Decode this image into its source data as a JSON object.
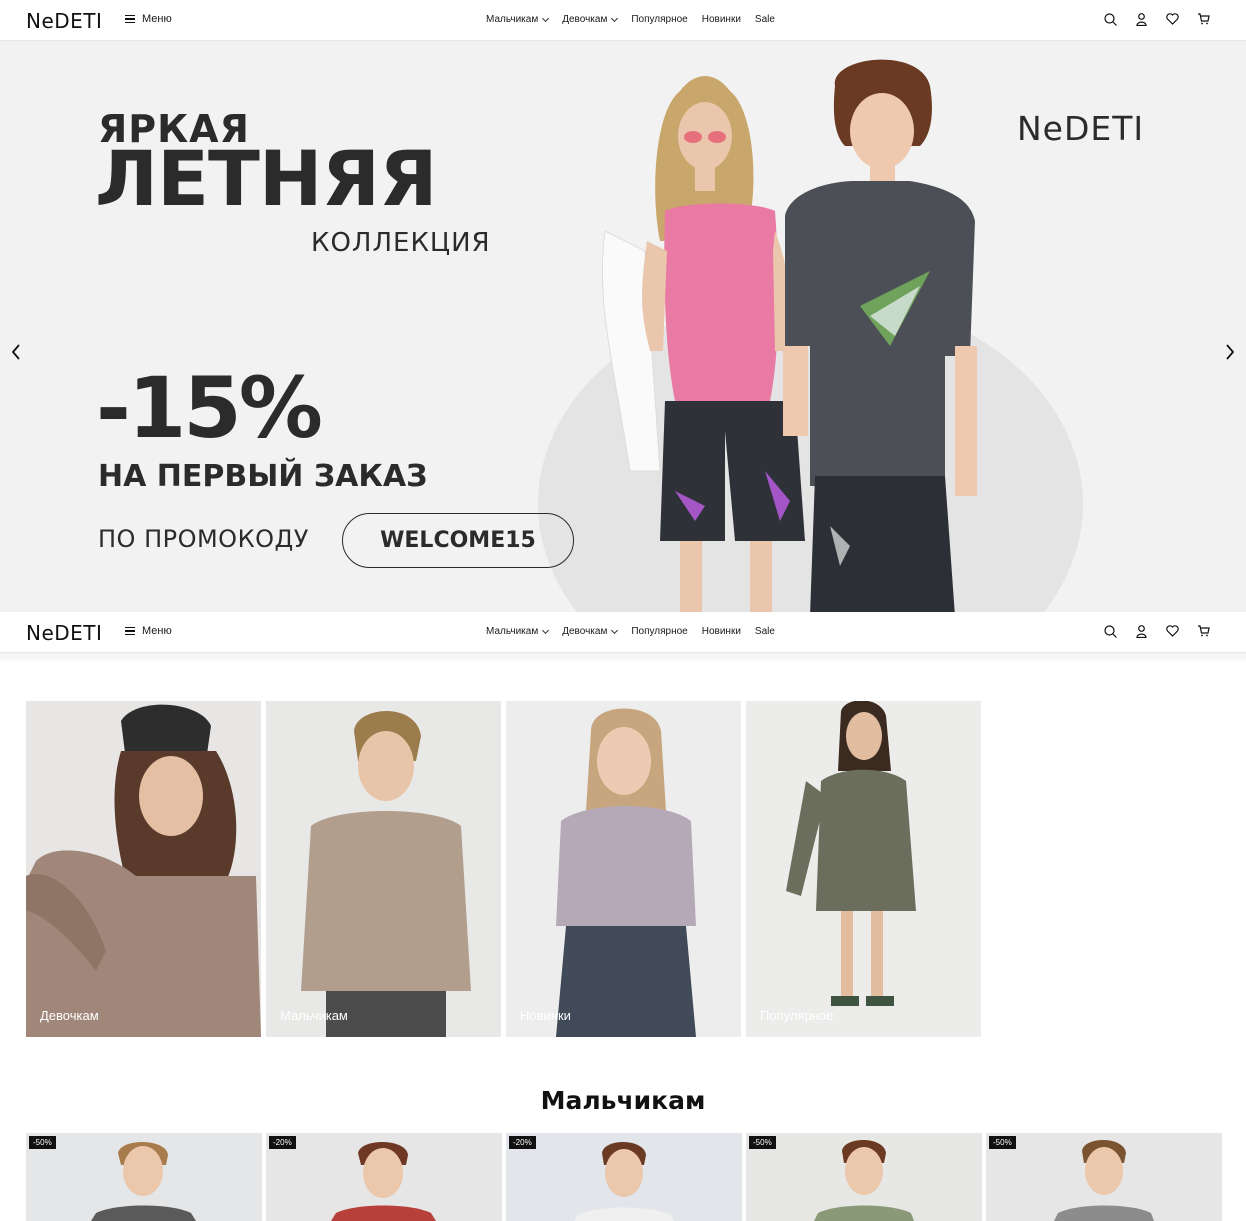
{
  "header": {
    "logo": "NeDETI",
    "menu_label": "Меню",
    "nav": [
      {
        "label": "Мальчикам",
        "dropdown": true
      },
      {
        "label": "Девочкам",
        "dropdown": true
      },
      {
        "label": "Популярное",
        "dropdown": false
      },
      {
        "label": "Новинки",
        "dropdown": false
      },
      {
        "label": "Sale",
        "dropdown": false
      }
    ],
    "icons": [
      "search-icon",
      "user-icon",
      "heart-icon",
      "cart-icon"
    ]
  },
  "hero": {
    "line1": "ЯРКАЯ",
    "line2": "ЛЕТНЯЯ",
    "line3": "КОЛЛЕКЦИЯ",
    "discount": "-15%",
    "first_order": "НА ПЕРВЫЙ ЗАКАЗ",
    "promo_label": "ПО ПРОМОКОДУ",
    "promo_code": "WELCOME15",
    "brand": "NeDETI"
  },
  "categories": [
    {
      "label": "Девочкам",
      "color": "#a08779"
    },
    {
      "label": "Мальчикам",
      "color": "#b19e8d"
    },
    {
      "label": "Новинки",
      "color": "#b5a9b8"
    },
    {
      "label": "Популярное",
      "color": "#6b6e5c"
    }
  ],
  "section": {
    "title": "Мальчикам"
  },
  "products": [
    {
      "badge": "-50%",
      "shirt": "#5a5a5a"
    },
    {
      "badge": "-20%",
      "shirt": "#b8403a"
    },
    {
      "badge": "-20%",
      "shirt": "#f0f0f0"
    },
    {
      "badge": "-50%",
      "shirt": "#8a9a78"
    },
    {
      "badge": "-50%",
      "shirt": "#8c8c8c"
    }
  ]
}
